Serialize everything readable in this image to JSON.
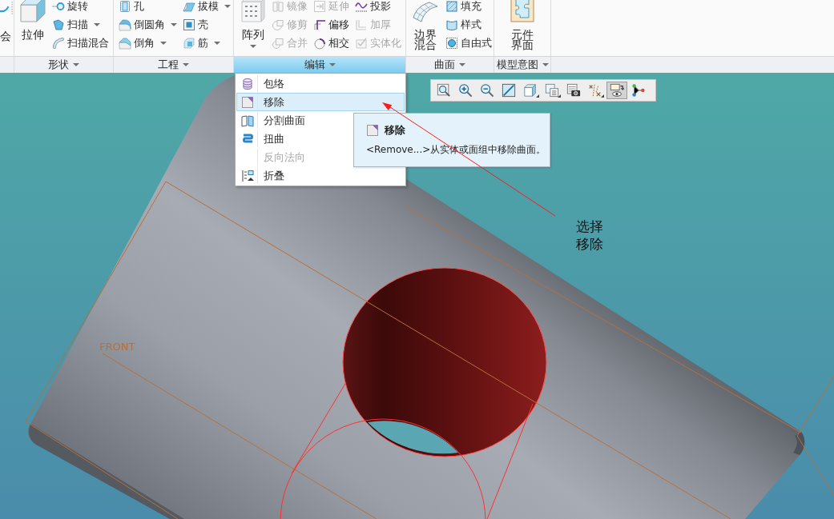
{
  "ribbon": {
    "partial_group": {
      "label": "会"
    },
    "groups": [
      {
        "label": "形状",
        "selected": false,
        "items": [
          {
            "kind": "large",
            "label": "拉伸",
            "dropdown": false,
            "disabled": false
          },
          {
            "kind": "stack",
            "buttons": [
              {
                "label": "旋转",
                "dropdown": false,
                "disabled": false
              },
              {
                "label": "扫描",
                "dropdown": true,
                "disabled": false
              },
              {
                "label": "扫描混合",
                "dropdown": false,
                "disabled": false
              }
            ]
          }
        ]
      },
      {
        "label": "工程",
        "selected": false,
        "items": [
          {
            "kind": "stack",
            "buttons": [
              {
                "label": "孔",
                "dropdown": false,
                "disabled": false
              },
              {
                "label": "倒圆角",
                "dropdown": true,
                "disabled": false
              },
              {
                "label": "倒角",
                "dropdown": true,
                "disabled": false
              }
            ]
          },
          {
            "kind": "stack",
            "buttons": [
              {
                "label": "拔模",
                "dropdown": true,
                "disabled": false
              },
              {
                "label": "壳",
                "dropdown": false,
                "disabled": false
              },
              {
                "label": "筋",
                "dropdown": true,
                "disabled": false
              }
            ]
          }
        ]
      },
      {
        "label": "编辑",
        "selected": true,
        "items": [
          {
            "kind": "large",
            "label": "阵列",
            "dropdown": true,
            "disabled": false
          },
          {
            "kind": "stack",
            "buttons": [
              {
                "label": "镜像",
                "dropdown": false,
                "disabled": true
              },
              {
                "label": "修剪",
                "dropdown": false,
                "disabled": true
              },
              {
                "label": "合并",
                "dropdown": false,
                "disabled": true
              }
            ]
          },
          {
            "kind": "stack",
            "buttons": [
              {
                "label": "延伸",
                "dropdown": false,
                "disabled": true
              },
              {
                "label": "偏移",
                "dropdown": false,
                "disabled": false
              },
              {
                "label": "相交",
                "dropdown": false,
                "disabled": false
              }
            ]
          },
          {
            "kind": "stack",
            "buttons": [
              {
                "label": "投影",
                "dropdown": false,
                "disabled": false
              },
              {
                "label": "加厚",
                "dropdown": false,
                "disabled": true
              },
              {
                "label": "实体化",
                "dropdown": false,
                "disabled": true
              }
            ]
          }
        ]
      },
      {
        "label": "曲面",
        "selected": false,
        "items": [
          {
            "kind": "large",
            "label": "边界混合",
            "dropdown": false,
            "disabled": false
          },
          {
            "kind": "stack",
            "buttons": [
              {
                "label": "填充",
                "dropdown": false,
                "disabled": false
              },
              {
                "label": "样式",
                "dropdown": false,
                "disabled": false
              },
              {
                "label": "自由式",
                "dropdown": false,
                "disabled": false
              }
            ]
          }
        ]
      },
      {
        "label": "模型意图",
        "selected": false,
        "items": [
          {
            "kind": "large",
            "label": "元件界面",
            "dropdown": false,
            "disabled": false
          }
        ]
      }
    ]
  },
  "dropdown_menu": {
    "items": [
      {
        "label": "包络",
        "selected": false,
        "disabled": false
      },
      {
        "label": "移除",
        "selected": true,
        "disabled": false
      },
      {
        "label": "分割曲面",
        "selected": false,
        "disabled": false
      },
      {
        "label": "扭曲",
        "selected": false,
        "disabled": false
      },
      {
        "label": "反向法向",
        "selected": false,
        "disabled": true
      },
      {
        "label": "折叠",
        "selected": false,
        "disabled": false
      }
    ]
  },
  "tooltip": {
    "title": "移除",
    "description": "<Remove...>从实体或面组中移除曲面。"
  },
  "view_toolbar": {
    "buttons": [
      {
        "selected": false,
        "dropdown": false
      },
      {
        "selected": false,
        "dropdown": false
      },
      {
        "selected": false,
        "dropdown": false
      },
      {
        "selected": false,
        "dropdown": false
      },
      {
        "selected": false,
        "dropdown": true
      },
      {
        "selected": false,
        "dropdown": true
      },
      {
        "selected": false,
        "dropdown": false
      },
      {
        "selected": false,
        "dropdown": true
      },
      {
        "selected": true,
        "dropdown": false
      },
      {
        "selected": false,
        "dropdown": false
      }
    ]
  },
  "graphics_area": {
    "datum_label": "FRONT",
    "annotation": "选择移除"
  }
}
